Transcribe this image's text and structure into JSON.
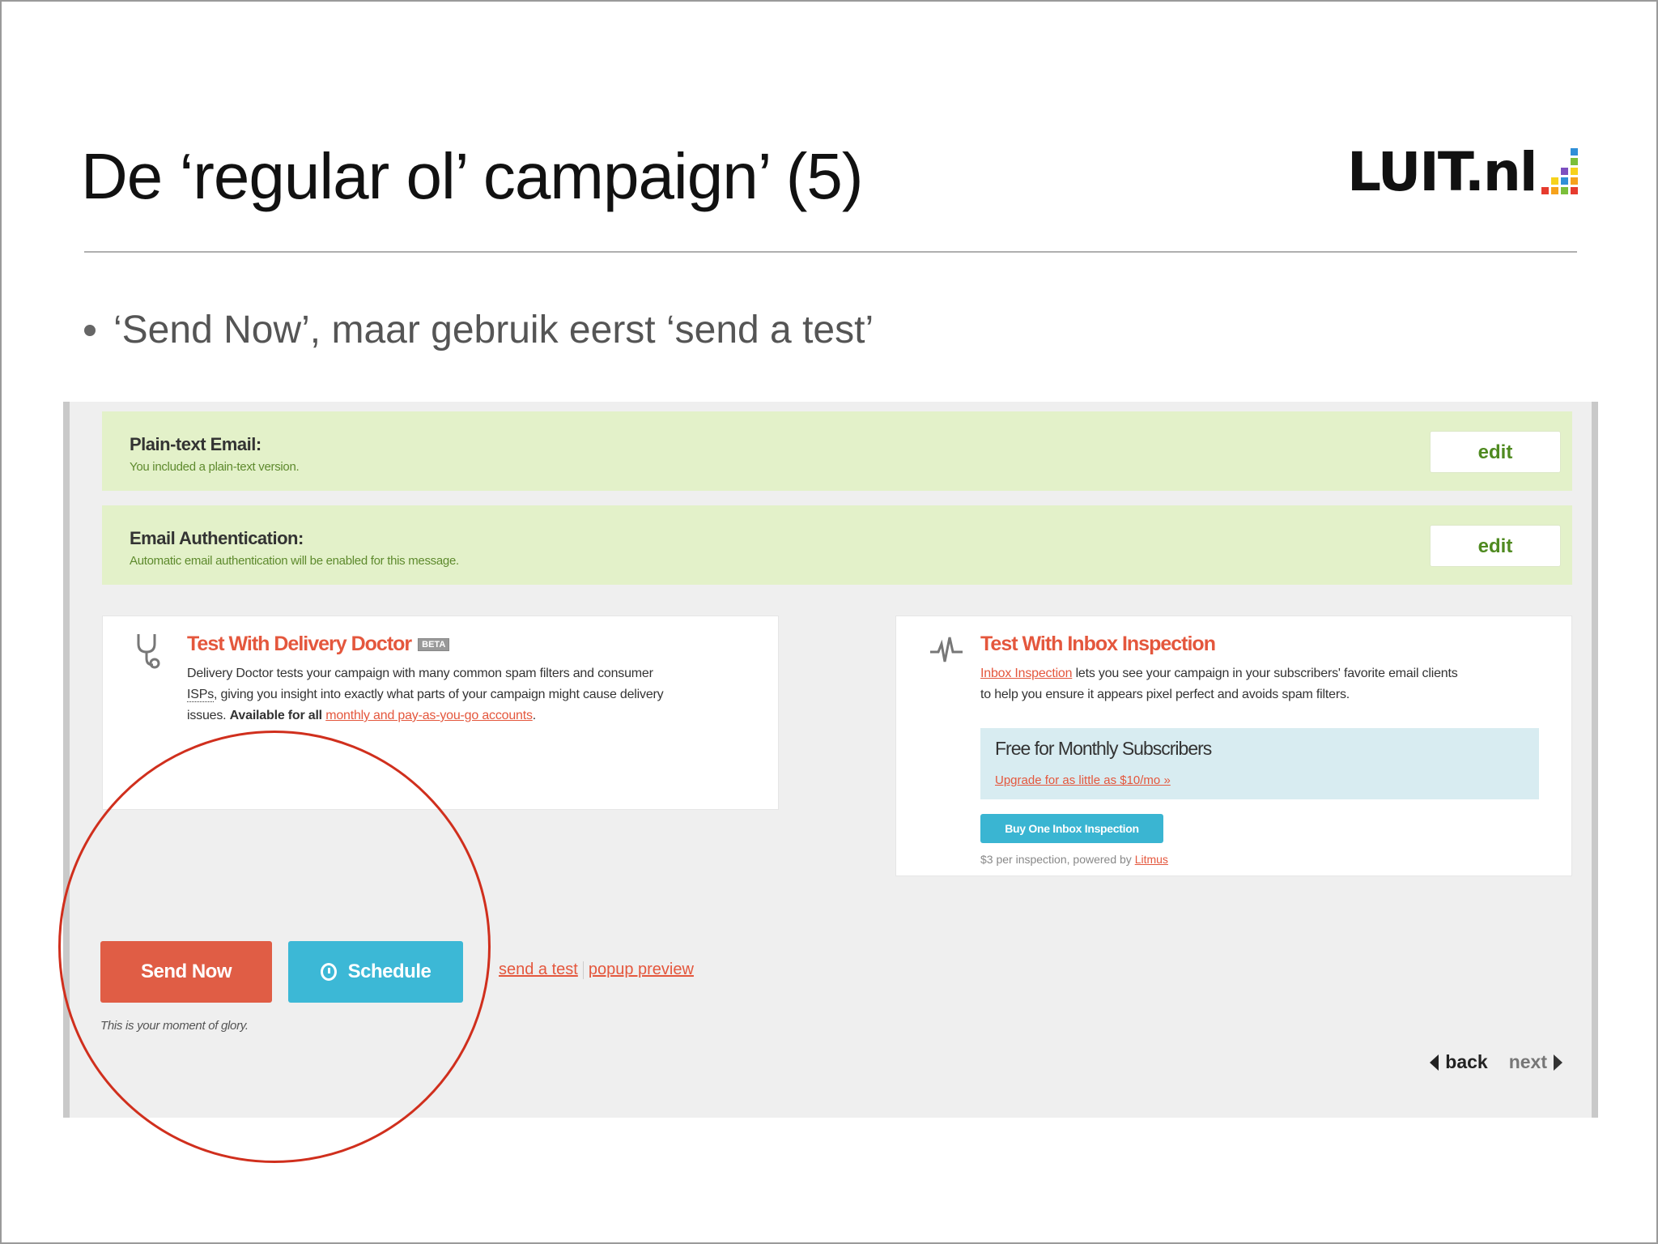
{
  "slide": {
    "title": "De ‘regular ol’ campaign’ (5)",
    "logo_text": "LUIT.nl",
    "bullet": "‘Send Now’, maar gebruik eerst ‘send a test’"
  },
  "colors": {
    "logo_bars": [
      "#e63b2e",
      "#f6a21c",
      "#f6d21c",
      "#7bbf3a",
      "#2f8fd8",
      "#7c4fc0"
    ],
    "panel_bg": "#e3f1c9",
    "accent_red": "#e4573d",
    "accent_blue": "#3cb8d6",
    "highlight_circle": "#d02f1d"
  },
  "panels": {
    "plain_text": {
      "title": "Plain-text Email:",
      "desc": "You included a plain-text version.",
      "edit": "edit"
    },
    "auth": {
      "title": "Email Authentication:",
      "desc": "Automatic email authentication will be enabled for this message.",
      "edit": "edit"
    }
  },
  "delivery_doctor": {
    "icon": "stethoscope-icon",
    "title": "Test With Delivery Doctor",
    "badge": "BETA",
    "body_1": "Delivery Doctor tests your campaign with many common spam filters and consumer",
    "body_isps": "ISPs",
    "body_2": ", giving you insight into exactly what parts of your campaign might cause delivery",
    "body_3": "issues. ",
    "body_bold": "Available for all ",
    "body_link": "monthly and pay-as-you-go accounts",
    "body_end": "."
  },
  "inbox_inspection": {
    "icon": "pulse-icon",
    "title": "Test With Inbox Inspection",
    "body_link": "Inbox Inspection",
    "body_1": " lets you see your campaign in your subscribers' favorite email clients",
    "body_2": "to help you ensure it appears pixel perfect and avoids spam filters.",
    "promo_title": "Free for Monthly Subscribers",
    "promo_link": "Upgrade for as little as $10/mo »",
    "buy_button": "Buy One Inbox Inspection",
    "buy_note": "$3 per inspection, powered by ",
    "buy_note_link": "Litmus"
  },
  "actions": {
    "send_now": "Send Now",
    "schedule": "Schedule",
    "send_test": "send a test",
    "popup_preview": "popup preview",
    "glory": "This is your moment of glory."
  },
  "pager": {
    "back": "back",
    "next": "next"
  }
}
